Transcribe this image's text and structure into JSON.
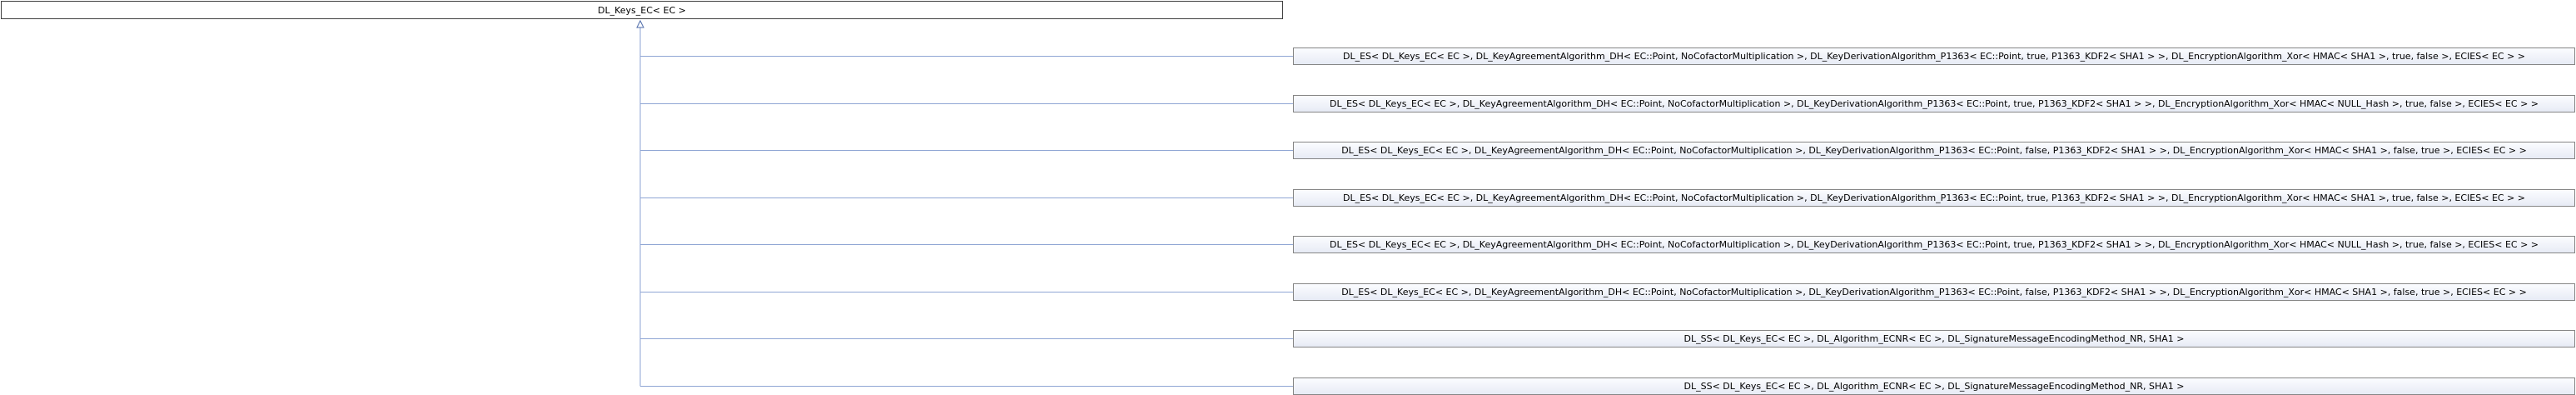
{
  "base_class": {
    "label": "DL_Keys_EC< EC >"
  },
  "derived_classes": [
    {
      "label": "DL_ES< DL_Keys_EC< EC >, DL_KeyAgreementAlgorithm_DH< EC::Point, NoCofactorMultiplication >, DL_KeyDerivationAlgorithm_P1363< EC::Point, true, P1363_KDF2< SHA1 > >, DL_EncryptionAlgorithm_Xor< HMAC< SHA1 >, true, false >, ECIES< EC > >"
    },
    {
      "label": "DL_ES< DL_Keys_EC< EC >, DL_KeyAgreementAlgorithm_DH< EC::Point, NoCofactorMultiplication >, DL_KeyDerivationAlgorithm_P1363< EC::Point, true, P1363_KDF2< SHA1 > >, DL_EncryptionAlgorithm_Xor< HMAC< NULL_Hash >, true, false >, ECIES< EC > >"
    },
    {
      "label": "DL_ES< DL_Keys_EC< EC >, DL_KeyAgreementAlgorithm_DH< EC::Point, NoCofactorMultiplication >, DL_KeyDerivationAlgorithm_P1363< EC::Point, false, P1363_KDF2< SHA1 > >, DL_EncryptionAlgorithm_Xor< HMAC< SHA1 >, false, true >, ECIES< EC > >"
    },
    {
      "label": "DL_ES< DL_Keys_EC< EC >, DL_KeyAgreementAlgorithm_DH< EC::Point, NoCofactorMultiplication >, DL_KeyDerivationAlgorithm_P1363< EC::Point, true, P1363_KDF2< SHA1 > >, DL_EncryptionAlgorithm_Xor< HMAC< SHA1 >, true, false >, ECIES< EC > >"
    },
    {
      "label": "DL_ES< DL_Keys_EC< EC >, DL_KeyAgreementAlgorithm_DH< EC::Point, NoCofactorMultiplication >, DL_KeyDerivationAlgorithm_P1363< EC::Point, true, P1363_KDF2< SHA1 > >, DL_EncryptionAlgorithm_Xor< HMAC< NULL_Hash >, true, false >, ECIES< EC > >"
    },
    {
      "label": "DL_ES< DL_Keys_EC< EC >, DL_KeyAgreementAlgorithm_DH< EC::Point, NoCofactorMultiplication >, DL_KeyDerivationAlgorithm_P1363< EC::Point, false, P1363_KDF2< SHA1 > >, DL_EncryptionAlgorithm_Xor< HMAC< SHA1 >, false, true >, ECIES< EC > >"
    },
    {
      "label": "DL_SS< DL_Keys_EC< EC >, DL_Algorithm_ECNR< EC >, DL_SignatureMessageEncodingMethod_NR, SHA1 >"
    },
    {
      "label": "DL_SS< DL_Keys_EC< EC >, DL_Algorithm_ECNR< EC >, DL_SignatureMessageEncodingMethod_NR, SHA1 >"
    }
  ],
  "colors": {
    "edge": "#8fa6d4",
    "arrow": "#4d6aa8"
  }
}
